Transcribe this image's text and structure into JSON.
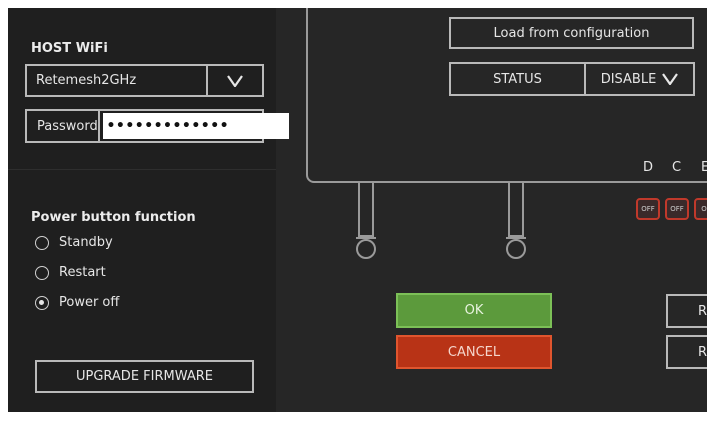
{
  "host_wifi": {
    "title": "HOST WiFi",
    "ssid_value": "Retemesh2GHz",
    "password_label": "Password",
    "password_value": "•••••••••••••"
  },
  "power": {
    "title": "Power button function",
    "options": [
      {
        "label": "Standby",
        "checked": false
      },
      {
        "label": "Restart",
        "checked": false
      },
      {
        "label": "Power off",
        "checked": true
      }
    ]
  },
  "upgrade_label": "UPGRADE FIRMWARE",
  "config": {
    "load_label": "Load from configuration",
    "status_label": "STATUS",
    "status_value": "DISABLE"
  },
  "columns": [
    "D",
    "C",
    "E"
  ],
  "badges": [
    "OFF",
    "OFF",
    "OF"
  ],
  "ok_label": "OK",
  "cancel_label": "CANCEL",
  "side_buttons": [
    "R",
    "R"
  ],
  "colors": {
    "ok": "#5c9a3c",
    "cancel": "#b83316",
    "off_border": "#c0392b"
  }
}
